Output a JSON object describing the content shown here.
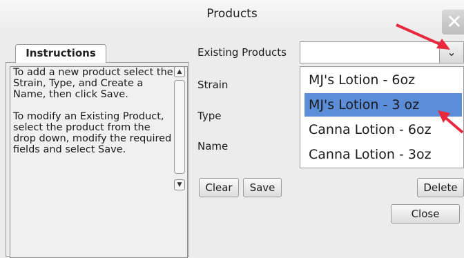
{
  "window": {
    "title": "Products",
    "close_glyph": "✕"
  },
  "instructions": {
    "tab_label": "Instructions",
    "paragraph1": "To add a new product select the Strain, Type, and Create a Name, then click Save.",
    "paragraph2": "To modify an Existing Product, select the product from the drop down, modify the required fields and select Save.",
    "scroll_up_icon": "▲",
    "scroll_down_icon": "▼"
  },
  "form": {
    "existing_products_label": "Existing Products",
    "existing_products_value": "",
    "strain_label": "Strain",
    "type_label": "Type",
    "name_label": "Name",
    "dropdown_icon": "⌄"
  },
  "dropdown": {
    "options": [
      "MJ's Lotion - 6oz",
      "MJ's Lotion - 3 oz",
      "Canna Lotion - 6oz",
      "Canna Lotion - 3oz"
    ],
    "selected": "MJ's Lotion - 3 oz"
  },
  "buttons": {
    "clear": "Clear",
    "save": "Save",
    "delete": "Delete",
    "close": "Close"
  },
  "colors": {
    "selection": "#5b8dd8",
    "annotation_arrow": "#e8283c"
  }
}
